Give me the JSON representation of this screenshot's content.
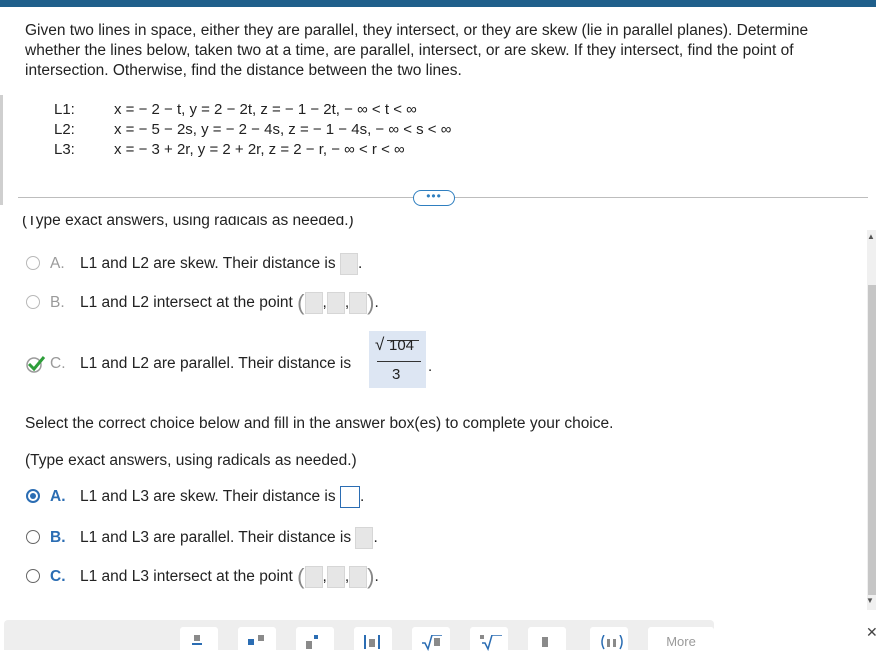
{
  "question": "Given two lines in space, either they are parallel, they intersect, or they are skew (lie in parallel planes). Determine whether the lines below, taken two at a time, are parallel, intersect, or are skew. If they intersect, find the point of intersection. Otherwise, find the distance between the two lines.",
  "lines": [
    {
      "label": "L1:",
      "equation": "x = − 2 − t, y = 2 − 2t, z = − 1 − 2t,  − ∞ < t < ∞"
    },
    {
      "label": "L2:",
      "equation": "x = − 5 − 2s, y = − 2 − 4s, z = − 1 − 4s,  − ∞ < s < ∞"
    },
    {
      "label": "L3:",
      "equation": "x = − 3 + 2r, y = 2 + 2r, z = 2 − r,  − ∞ < r < ∞"
    }
  ],
  "more_pill": "•••",
  "part1": {
    "instruction_cut": "(Type exact answers, using radicals as needed.)",
    "options": [
      {
        "letter": "A.",
        "text": "L1 and L2 are skew. Their distance is"
      },
      {
        "letter": "B.",
        "text": "L1 and L2 intersect at the point"
      },
      {
        "letter": "C.",
        "text": "L1 and L2 are parallel. Their distance is"
      }
    ],
    "answer_numerator": "104",
    "answer_denominator": "3"
  },
  "part2": {
    "prompt": "Select the correct choice below and fill in the answer box(es) to complete your choice.",
    "instruction": "(Type exact answers, using radicals as needed.)",
    "options": [
      {
        "letter": "A.",
        "text": "L1 and L3 are skew. Their distance is"
      },
      {
        "letter": "B.",
        "text": "L1 and L3 are parallel. Their distance is"
      },
      {
        "letter": "C.",
        "text": "L1 and L3 intersect at the point"
      }
    ]
  },
  "toolbar": {
    "more_label": "More"
  },
  "colors": {
    "accent": "#2b6db3",
    "topbar": "#1f5f8b",
    "answer_bg": "#dde6f3",
    "check": "#2e9e3a"
  }
}
